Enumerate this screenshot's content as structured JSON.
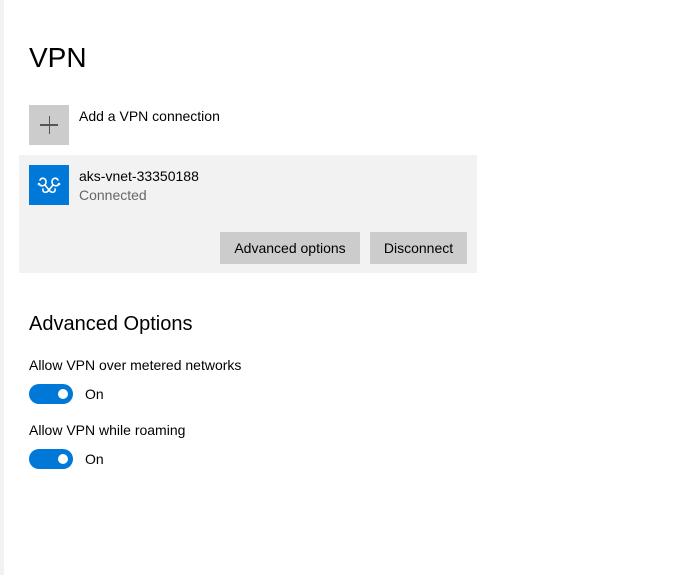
{
  "page": {
    "title": "VPN"
  },
  "add_connection": {
    "label": "Add a VPN connection",
    "icon": "plus-icon"
  },
  "connection": {
    "name": "aks-vnet-33350188",
    "status": "Connected",
    "icon": "vpn-icon",
    "advanced_button": "Advanced options",
    "disconnect_button": "Disconnect"
  },
  "advanced": {
    "title": "Advanced Options",
    "options": [
      {
        "label": "Allow VPN over metered networks",
        "state": "On",
        "enabled": true
      },
      {
        "label": "Allow VPN while roaming",
        "state": "On",
        "enabled": true
      }
    ]
  },
  "colors": {
    "accent": "#0078d7",
    "tile_gray": "#cccccc",
    "card_bg": "#f2f2f2",
    "secondary_text": "#666666"
  }
}
